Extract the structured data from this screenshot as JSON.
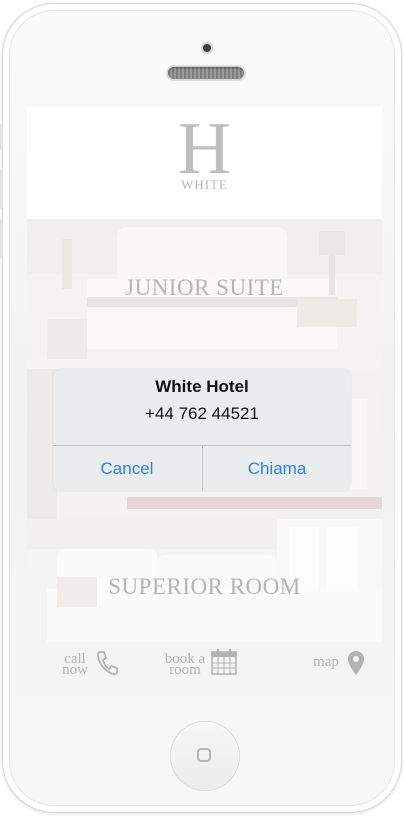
{
  "hotel": {
    "logo_letter": "H",
    "logo_word": "WHITE"
  },
  "rooms": [
    {
      "title": "JUNIOR SUITE"
    },
    {
      "title": "SUPERIOR ROOM"
    }
  ],
  "tabbar": {
    "call_line1": "call",
    "call_line2": "now",
    "call_icon": "phone-icon",
    "book_line1": "book a",
    "book_line2": "room",
    "book_icon": "calendar-icon",
    "map_label": "map",
    "map_icon": "map-pin-icon"
  },
  "alert": {
    "title": "White Hotel",
    "message": "+44 762 44521",
    "cancel_label": "Cancel",
    "confirm_label": "Chiama",
    "button_color": "#2f80e8"
  },
  "colors": {
    "phone_body": "#f4f4f4",
    "title_gray": "#8c8c8c"
  }
}
